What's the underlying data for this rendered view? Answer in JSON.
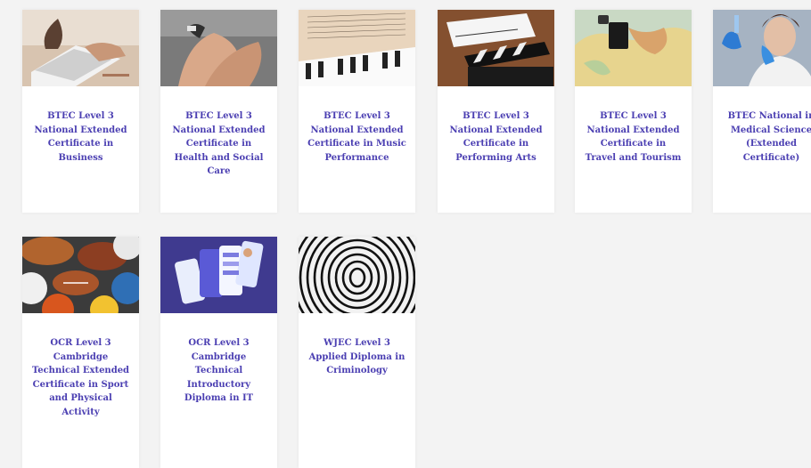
{
  "courses": [
    {
      "title": "BTEC Level 3 National Extended Certificate in Business",
      "image": "laptop-typing"
    },
    {
      "title": "BTEC Level 3 National Extended Certificate in Health and Social Care",
      "image": "holding-hands"
    },
    {
      "title": "BTEC Level 3 National Extended Certificate in Music Performance",
      "image": "piano-sheet-music"
    },
    {
      "title": "BTEC Level 3 National Extended Certificate in Performing Arts",
      "image": "film-clapperboard"
    },
    {
      "title": "BTEC Level 3 National Extended Certificate in Travel and Tourism",
      "image": "world-map-passport"
    },
    {
      "title": "BTEC National in Medical Science (Extended Certificate)",
      "image": "scientist-lab"
    },
    {
      "title": "OCR Level 3 Cambridge Technical Extended Certificate in Sport and Physical Activity",
      "image": "sports-balls"
    },
    {
      "title": "OCR Level 3 Cambridge Technical Introductory Diploma in IT",
      "image": "mobile-app-screens"
    },
    {
      "title": "WJEC Level 3 Applied Diploma in Criminology",
      "image": "fingerprint"
    }
  ],
  "colors": {
    "title_text": "#4b3fb2",
    "background": "#f3f3f3",
    "card": "#ffffff"
  }
}
